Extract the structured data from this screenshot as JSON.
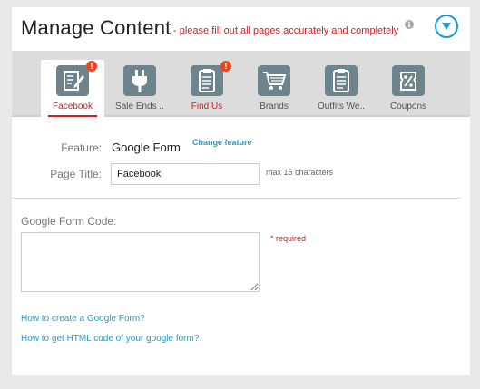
{
  "header": {
    "title": "Manage Content",
    "warning": "- please fill out all pages accurately and completely",
    "info_icon": "info-icon",
    "toggle_icon": "chevron-down-circle-icon"
  },
  "tabs": [
    {
      "label": "Facebook",
      "icon": "edit-document-icon",
      "active": true,
      "alert": true
    },
    {
      "label": "Sale Ends ..",
      "icon": "plug-icon",
      "active": false,
      "alert": false
    },
    {
      "label": "Find Us",
      "icon": "clipboard-list-icon",
      "active": false,
      "alert": true
    },
    {
      "label": "Brands",
      "icon": "cart-icon",
      "active": false,
      "alert": false
    },
    {
      "label": "Outfits We..",
      "icon": "clipboard-list-icon",
      "active": false,
      "alert": false
    },
    {
      "label": "Coupons",
      "icon": "coupon-percent-icon",
      "active": false,
      "alert": false
    }
  ],
  "alert_glyph": "!",
  "form": {
    "feature_label": "Feature:",
    "feature_value": "Google Form",
    "change_feature": "Change feature",
    "page_title_label": "Page Title:",
    "page_title_value": "Facebook",
    "page_title_hint": "max 15 characters",
    "code_label": "Google Form Code:",
    "code_value": "",
    "required": "* required"
  },
  "links": {
    "create_form": "How to create a Google Form?",
    "get_html": "How to get HTML code of your google form?"
  },
  "colors": {
    "accent_blue": "#1a9ad6",
    "alert_red": "#cc2222",
    "icon_bg": "#6e848d"
  }
}
